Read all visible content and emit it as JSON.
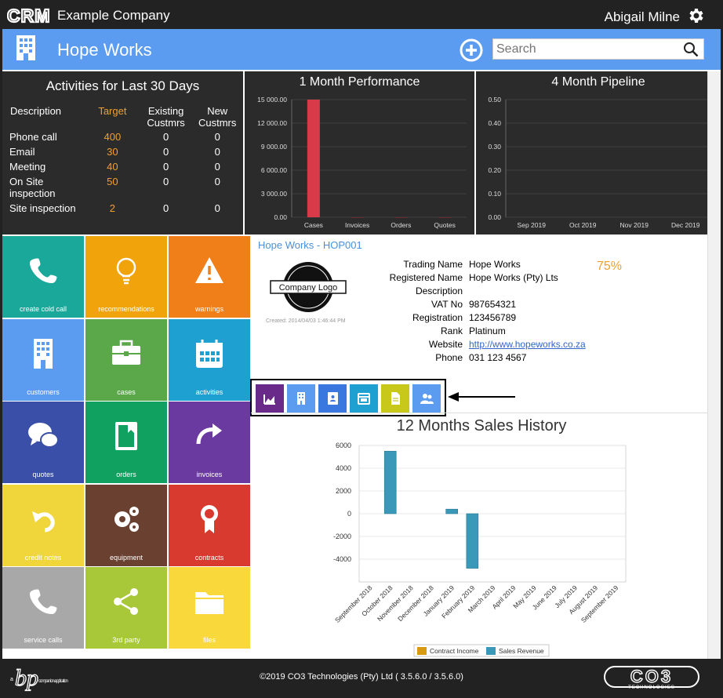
{
  "topbar": {
    "app_logo": "CRM",
    "company": "Example Company",
    "user": "Abigail Milne",
    "icons": [
      "gear-icon"
    ]
  },
  "header": {
    "title": "Hope Works",
    "search_placeholder": "Search",
    "icons": [
      "building-icon",
      "plus-circle-icon",
      "search-icon"
    ]
  },
  "activities": {
    "title": "Activities for Last 30 Days",
    "columns": [
      "Description",
      "Target",
      "Existing Custmrs",
      "New Custmrs"
    ],
    "rows": [
      {
        "desc": "Phone call",
        "target": "400",
        "existing": "0",
        "new": "0"
      },
      {
        "desc": "Email",
        "target": "30",
        "existing": "0",
        "new": "0"
      },
      {
        "desc": "Meeting",
        "target": "40",
        "existing": "0",
        "new": "0"
      },
      {
        "desc": "On Site inspection",
        "target": "50",
        "existing": "0",
        "new": "0"
      },
      {
        "desc": "Site inspection",
        "target": "2",
        "existing": "0",
        "new": "0"
      }
    ]
  },
  "performance": {
    "title": "1 Month Performance",
    "chart_data": {
      "type": "bar",
      "categories": [
        "Cases",
        "Invoices",
        "Orders",
        "Quotes"
      ],
      "values": [
        15000,
        0,
        0,
        0
      ],
      "ylim": [
        0,
        15000
      ],
      "yticks": [
        "0.00",
        "3 000.00",
        "6 000.00",
        "9 000.00",
        "12 000.00",
        "15 000.00"
      ],
      "color": "#d93a4a"
    }
  },
  "pipeline": {
    "title": "4 Month Pipeline",
    "chart_data": {
      "type": "bar",
      "categories": [
        "Sep 2019",
        "Oct 2019",
        "Nov 2019",
        "Dec 2019"
      ],
      "values": [
        0,
        0,
        0,
        0
      ],
      "ylim": [
        0,
        0.5
      ],
      "yticks": [
        "0.00",
        "0.10",
        "0.20",
        "0.30",
        "0.40",
        "0.50"
      ]
    }
  },
  "tiles": [
    {
      "label": "create cold call",
      "icon": "phone-icon",
      "color": "#1aa89a"
    },
    {
      "label": "recommendations",
      "icon": "lightbulb-icon",
      "color": "#f0a30a"
    },
    {
      "label": "warnings",
      "icon": "warning-icon",
      "color": "#f07f1a"
    },
    {
      "label": "customers",
      "icon": "building-icon",
      "color": "#5b9cf1"
    },
    {
      "label": "cases",
      "icon": "briefcase-icon",
      "color": "#5aa84a"
    },
    {
      "label": "activities",
      "icon": "calendar-icon",
      "color": "#1ea0d0"
    },
    {
      "label": "quotes",
      "icon": "chat-icon",
      "color": "#3a4fa8"
    },
    {
      "label": "orders",
      "icon": "book-icon",
      "color": "#10a060"
    },
    {
      "label": "invoices",
      "icon": "redo-arrow-icon",
      "color": "#6a3aa0"
    },
    {
      "label": "credit notes",
      "icon": "undo-arrow-icon",
      "color": "#f0d63a"
    },
    {
      "label": "equipment",
      "icon": "gears-icon",
      "color": "#6a4030"
    },
    {
      "label": "contracts",
      "icon": "ribbon-icon",
      "color": "#d83a30"
    },
    {
      "label": "service calls",
      "icon": "phone-icon",
      "color": "#a8a8a8"
    },
    {
      "label": "3rd party",
      "icon": "share-icon",
      "color": "#a8c83a"
    },
    {
      "label": "files",
      "icon": "folder-icon",
      "color": "#f8d83a"
    }
  ],
  "company": {
    "code": "Hope Works - HOP001",
    "logo_text": "Company Logo",
    "created": "Created: 2014/04/03 1:46:44 PM",
    "score": "75%",
    "fields": [
      {
        "k": "Trading Name",
        "v": "Hope Works"
      },
      {
        "k": "Registered Name",
        "v": "Hope Works (Pty) Lts"
      },
      {
        "k": "Description",
        "v": ""
      },
      {
        "k": "VAT No",
        "v": "987654321"
      },
      {
        "k": "Registration",
        "v": "123456789"
      },
      {
        "k": "Rank",
        "v": "Platinum"
      },
      {
        "k": "Website",
        "v": "http://www.hopeworks.co.za"
      },
      {
        "k": "Phone",
        "v": "031 123 4567"
      }
    ]
  },
  "toolbar_icons": [
    {
      "name": "chart-icon",
      "color": "#6a2a8a"
    },
    {
      "name": "building-icon",
      "color": "#5b9cf1"
    },
    {
      "name": "contacts-book-icon",
      "color": "#3a78e0"
    },
    {
      "name": "calendar-icon",
      "color": "#1ea0d0"
    },
    {
      "name": "document-icon",
      "color": "#c8c81a"
    },
    {
      "name": "people-icon",
      "color": "#5b9cf1"
    }
  ],
  "sales": {
    "title": "12 Months Sales History",
    "chart_data": {
      "type": "bar",
      "categories": [
        "September 2018",
        "October 2018",
        "November 2018",
        "December 2018",
        "January 2019",
        "February 2019",
        "March 2019",
        "April 2019",
        "May 2019",
        "June 2019",
        "July 2019",
        "August 2019",
        "September 2019"
      ],
      "series": [
        {
          "name": "Contract Income",
          "values": [
            0,
            0,
            0,
            0,
            0,
            0,
            0,
            0,
            0,
            0,
            0,
            0,
            0
          ],
          "color": "#d89a10"
        },
        {
          "name": "Sales Revenue",
          "values": [
            0,
            5500,
            0,
            0,
            400,
            -4800,
            0,
            0,
            0,
            0,
            0,
            0,
            0
          ],
          "color": "#3a98b8"
        }
      ],
      "ylim": [
        -6000,
        6000
      ],
      "yticks": [
        "6000",
        "4000",
        "2000",
        "0",
        "-2000",
        "-4000"
      ]
    }
  },
  "footer": {
    "text": "©2019 CO3 Technologies (Pty) Ltd ( 3.5.6.0 / 3.5.6.0)",
    "left_logo_small": "a",
    "left_logo_text": "companion application",
    "right_logo_text": "TECHNOLOGIES",
    "right_logo": "CO3"
  }
}
